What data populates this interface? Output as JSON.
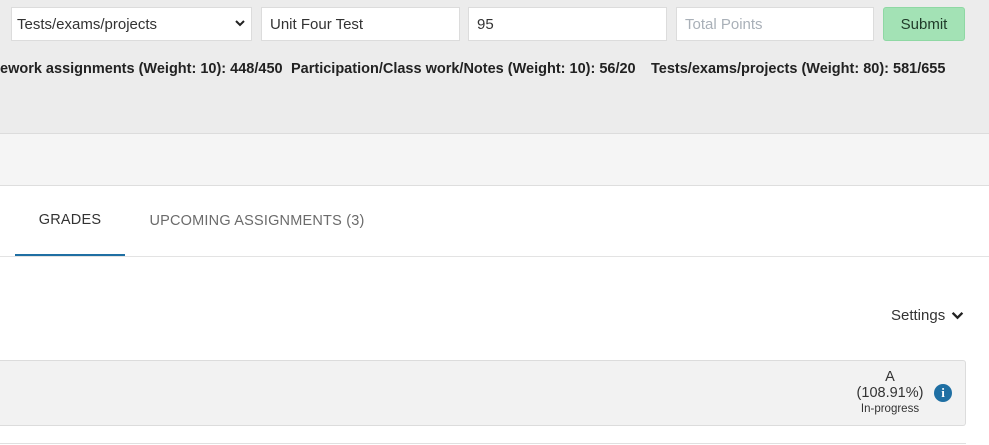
{
  "form": {
    "category_select": {
      "selected": "Tests/exams/projects",
      "options": [
        "Tests/exams/projects"
      ]
    },
    "assignment_name_value": "Unit Four Test",
    "points_earned_value": "95",
    "total_points_placeholder": "Total Points",
    "submit_label": "Submit"
  },
  "weights": [
    {
      "text": "ework assignments (Weight: 10): 448/450"
    },
    {
      "text": "Participation/Class work/Notes (Weight: 10): 56/20"
    },
    {
      "text": "Tests/exams/projects (Weight: 80): 581/655"
    }
  ],
  "tabs": [
    {
      "label": "GRADES",
      "active": true
    },
    {
      "label": "UPCOMING ASSIGNMENTS (3)",
      "active": false
    }
  ],
  "settings_label": "Settings",
  "grade": {
    "letter": "A",
    "percent": "(108.91%)",
    "status": "In-progress"
  },
  "icons": {
    "select_chevron": "chevron-down-icon",
    "settings_chevron": "chevron-down-icon",
    "info": "info-icon"
  },
  "colors": {
    "accent": "#1f6fa3",
    "submit_bg": "#a3e2b5",
    "panel_bg": "#ececec"
  }
}
